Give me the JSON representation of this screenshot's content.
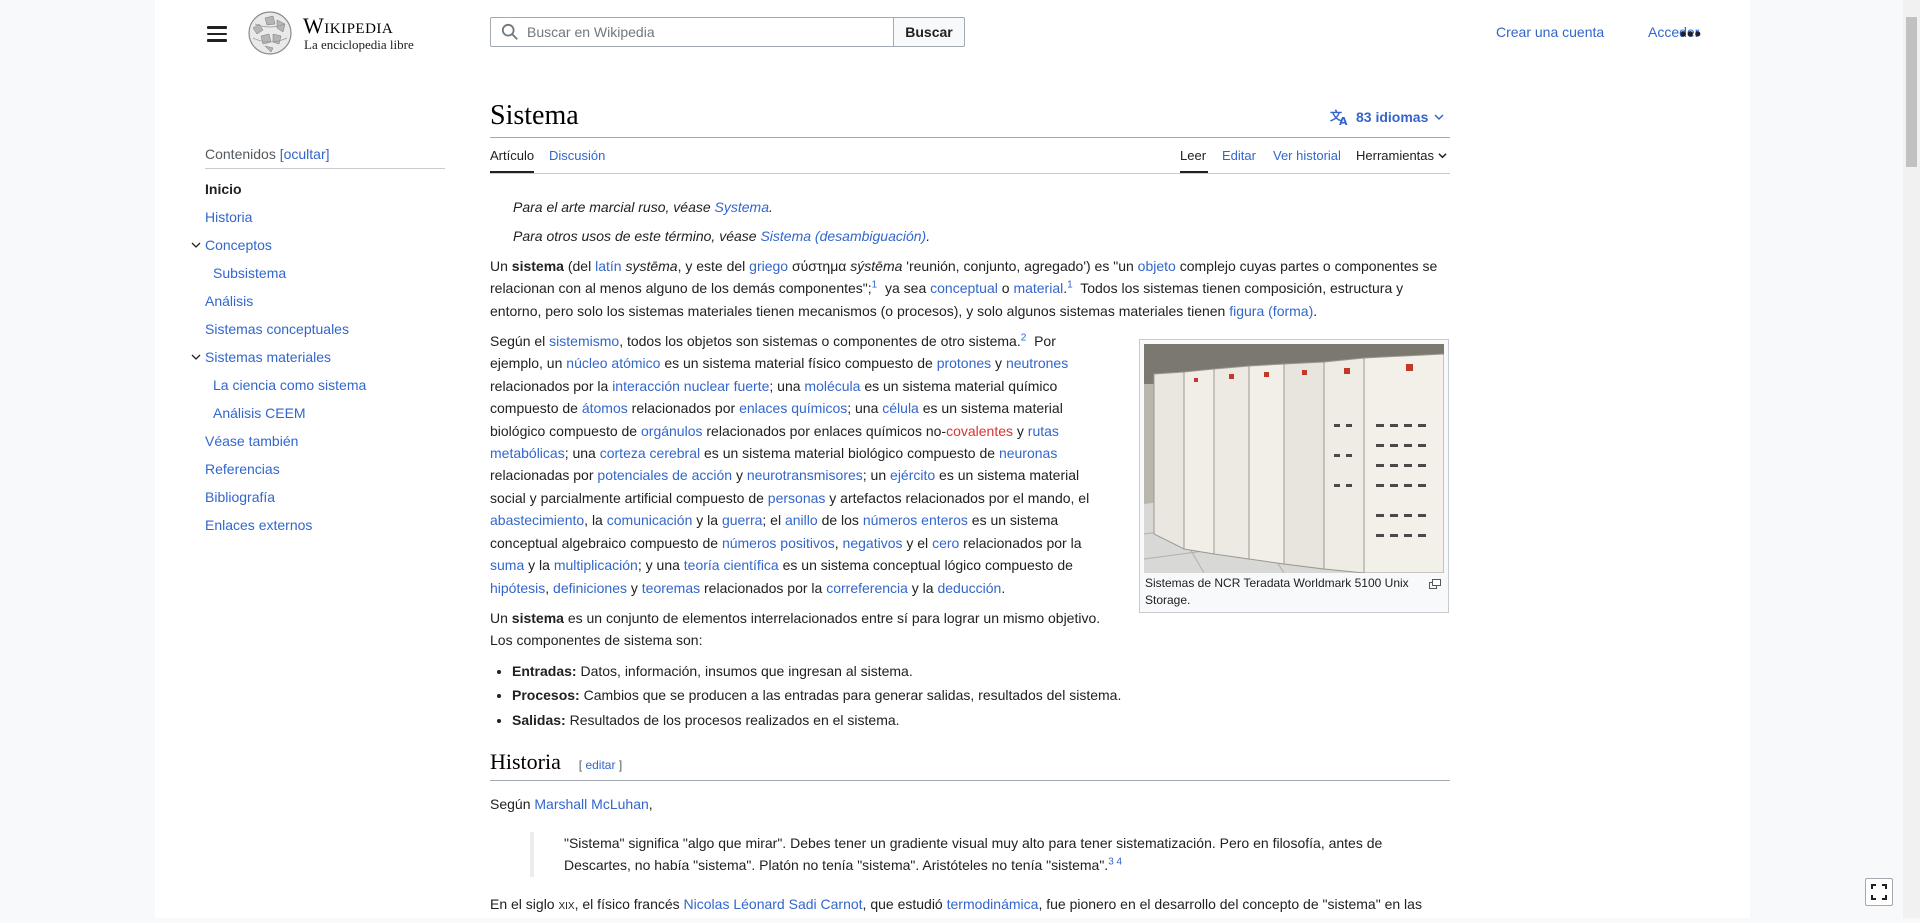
{
  "header": {
    "wordmark": "Wikipedia",
    "tagline": "La enciclopedia libre",
    "search_placeholder": "Buscar en Wikipedia",
    "search_button": "Buscar",
    "create_account": "Crear una cuenta",
    "login": "Acceder",
    "more": "•••"
  },
  "toc": {
    "title": "Contenidos",
    "hide": "[ocultar]",
    "items": [
      {
        "label": "Inicio"
      },
      {
        "label": "Historia"
      },
      {
        "label": "Conceptos"
      },
      {
        "label": "Subsistema"
      },
      {
        "label": "Análisis"
      },
      {
        "label": "Sistemas conceptuales"
      },
      {
        "label": "Sistemas materiales"
      },
      {
        "label": "La ciencia como sistema"
      },
      {
        "label": "Análisis CEEM"
      },
      {
        "label": "Véase también"
      },
      {
        "label": "Referencias"
      },
      {
        "label": "Bibliografía"
      },
      {
        "label": "Enlaces externos"
      }
    ]
  },
  "article": {
    "title": "Sistema",
    "languages": "83 idiomas",
    "tabs": {
      "article": "Artículo",
      "discussion": "Discusión",
      "read": "Leer",
      "edit": "Editar",
      "history": "Ver historial",
      "tools": "Herramientas"
    },
    "hatnote1_pre": "Para el arte marcial ruso, véase ",
    "hatnote1_link": "Systema",
    "hatnote2_pre": "Para otros usos de este término, véase ",
    "hatnote2_link": "Sistema (desambiguación)",
    "thumb_caption": "Sistemas de NCR Teradata Worldmark 5100 Unix Storage.",
    "list": [
      {
        "term": "Entradas:",
        "text": " Datos, información, insumos que ingresan al sistema."
      },
      {
        "term": "Procesos:",
        "text": " Cambios que se producen a las entradas para generar salidas, resultados del sistema."
      },
      {
        "term": "Salidas:",
        "text": " Resultados de los procesos realizados en el sistema."
      }
    ],
    "history_heading": "Historia",
    "edit_label": "editar",
    "segun": "Según ",
    "mcluhan": "Marshall McLuhan",
    "quote": "\"Sistema\" significa \"algo que mirar\". Debes tener un gradiente visual muy alto para tener sistematización. Pero en filosofía, antes de Descartes, no había \"sistema\". Platón no tenía \"sistema\". Aristóteles no tenía \"sistema\".",
    "quote_refs": "3 4",
    "last_pre": "En el siglo ",
    "last_century": "xix",
    "last_mid": ", el físico francés ",
    "last_link1": "Nicolas Léonard Sadi Carnot",
    "last_mid2": ", que estudió ",
    "last_link2": "termodinámica",
    "last_post": ", fue pionero en el desarrollo del concepto de \"sistema\" en las"
  }
}
